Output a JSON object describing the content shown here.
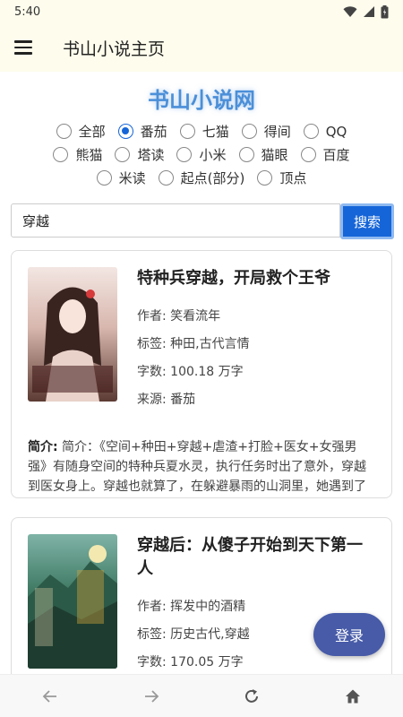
{
  "status_bar": {
    "time": "5:40"
  },
  "app_bar": {
    "title": "书山小说主页"
  },
  "site_title": "书山小说网",
  "sources": {
    "row1": [
      {
        "label": "全部",
        "checked": false
      },
      {
        "label": "番茄",
        "checked": true
      },
      {
        "label": "七猫",
        "checked": false
      },
      {
        "label": "得间",
        "checked": false
      },
      {
        "label": "QQ",
        "checked": false
      }
    ],
    "row2": [
      {
        "label": "熊猫",
        "checked": false
      },
      {
        "label": "塔读",
        "checked": false
      },
      {
        "label": "小米",
        "checked": false
      },
      {
        "label": "猫眼",
        "checked": false
      },
      {
        "label": "百度",
        "checked": false
      }
    ],
    "row3": [
      {
        "label": "米读",
        "checked": false
      },
      {
        "label": "起点(部分)",
        "checked": false
      },
      {
        "label": "顶点",
        "checked": false
      }
    ]
  },
  "search": {
    "value": "穿越",
    "button_label": "搜索"
  },
  "books": [
    {
      "title": "特种兵穿越，开局救个王爷",
      "author": "作者: 笑看流年",
      "tags": "标签: 种田,古代言情",
      "words": "字数: 100.18 万字",
      "source": "来源: 番茄",
      "summary_label": "简介:",
      "summary": " 简介：《空间+种田+穿越+虐渣+打脸+医女+女强男强》有随身空间的特种兵夏水灵，执行任务时出了意外，穿越到医女身上。穿越也就算了，在躲避暴雨的山洞里，她遇到了一…"
    },
    {
      "title": "穿越后：从傻子开始到天下第一人",
      "author": "作者: 挥发中的酒精",
      "tags": "标签: 历史古代,穿越",
      "words": "字数: 170.05 万字",
      "source": "",
      "summary_label": "",
      "summary": ""
    }
  ],
  "login_button": "登录",
  "colors": {
    "accent": "#1565d8",
    "fab": "#475ba8",
    "title": "#4b8fd8",
    "app_bar_bg": "#fefcec"
  }
}
